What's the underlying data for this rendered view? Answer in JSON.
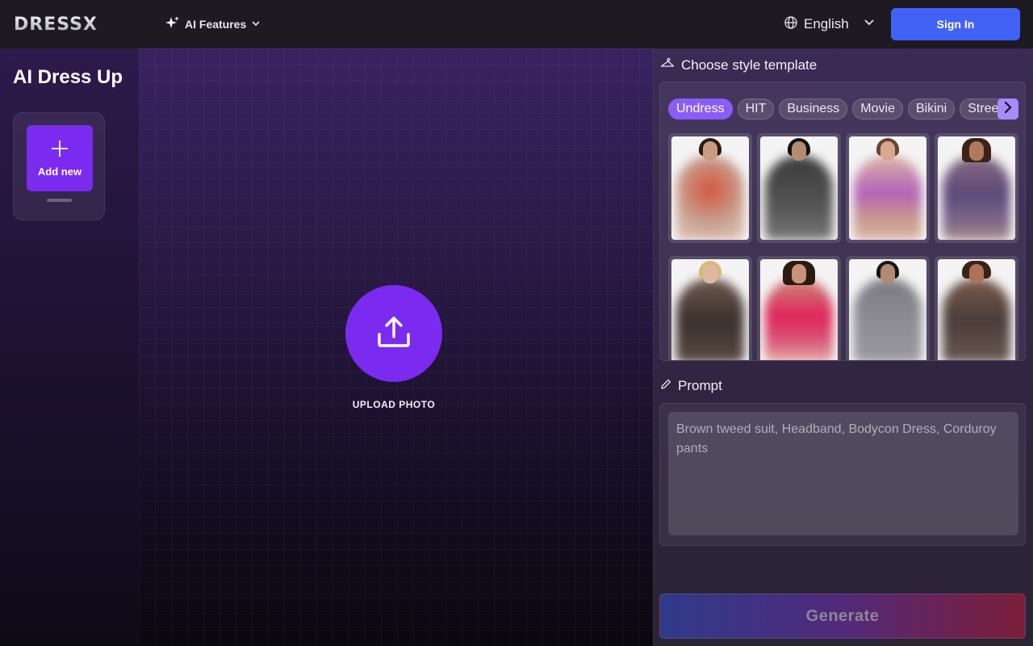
{
  "header": {
    "logo": "DRESSX",
    "ai_features": "AI Features",
    "language": "English",
    "sign_in": "Sign In"
  },
  "sidebar": {
    "title": "AI Dress Up",
    "add_new": "Add new"
  },
  "canvas": {
    "upload_label": "UPLOAD PHOTO"
  },
  "panel": {
    "template_heading": "Choose style template",
    "chips": [
      "Undress",
      "HIT",
      "Business",
      "Movie",
      "Bikini",
      "Street"
    ],
    "active_chip": "Undress",
    "prompt_heading": "Prompt",
    "prompt_placeholder": "Brown tweed suit, Headband, Bodycon Dress, Corduroy pants",
    "generate": "Generate"
  },
  "colors": {
    "accent": "#7b2bf0",
    "sign_in_blue": "#4262f5",
    "chip_active": "#8b5cf6"
  }
}
